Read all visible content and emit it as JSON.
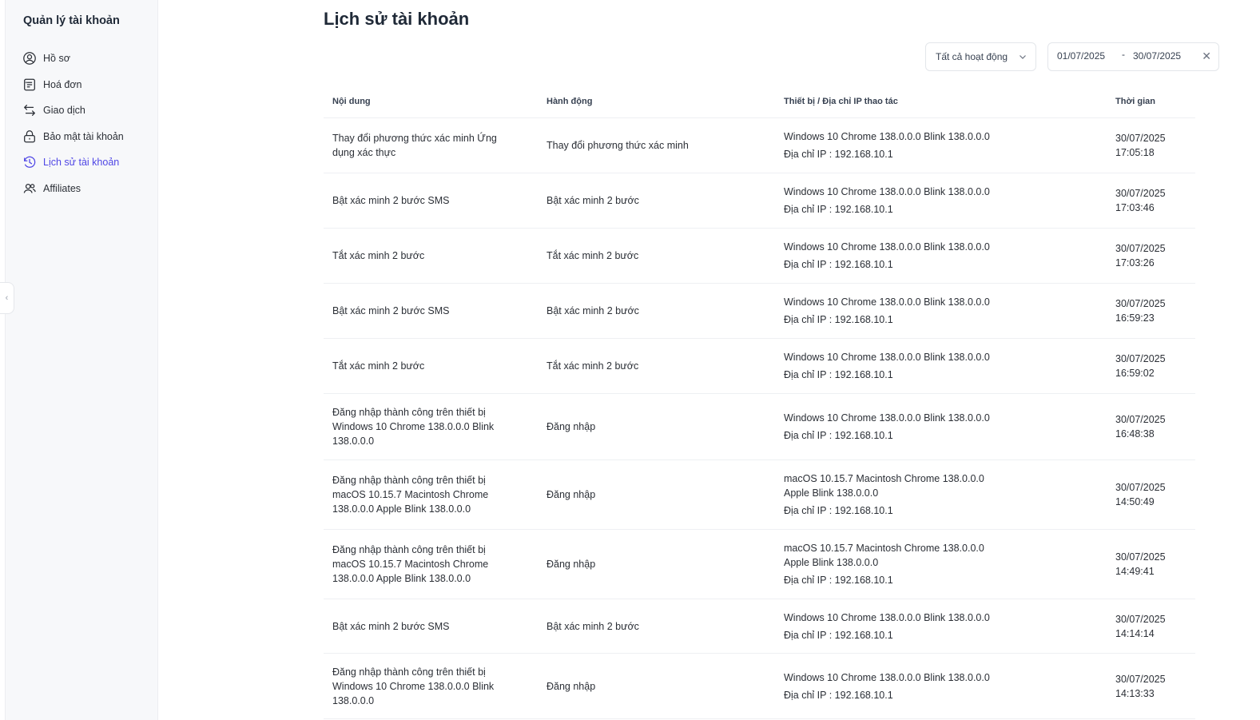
{
  "sidebar": {
    "title": "Quản lý tài khoản",
    "items": [
      {
        "label": "Hồ sơ",
        "icon": "user-circle-icon"
      },
      {
        "label": "Hoá đơn",
        "icon": "receipt-icon"
      },
      {
        "label": "Giao dịch",
        "icon": "transfer-arrows-icon"
      },
      {
        "label": "Bảo mật tài khoản",
        "icon": "lock-icon"
      },
      {
        "label": "Lịch sử tài khoản",
        "icon": "history-clock-icon",
        "active": true
      },
      {
        "label": "Affiliates",
        "icon": "users-icon"
      }
    ],
    "active_color": "#4f46e5"
  },
  "page": {
    "title": "Lịch sử tài khoản"
  },
  "filters": {
    "activity_select": "Tất cả hoạt động",
    "date_from": "01/07/2025",
    "date_separator": "-",
    "date_to": "30/07/2025"
  },
  "table": {
    "headers": {
      "content": "Nội dung",
      "action": "Hành động",
      "device": "Thiết bị / Địa chỉ IP thao tác",
      "time": "Thời gian"
    },
    "rows": [
      {
        "content": "Thay đổi phương thức xác minh Ứng dụng xác thực",
        "action": "Thay đổi phương thức xác minh",
        "device": "Windows 10 Chrome 138.0.0.0 Blink 138.0.0.0",
        "ip": "Địa chỉ IP : 192.168.10.1",
        "date": "30/07/2025",
        "clock": "17:05:18"
      },
      {
        "content": "Bật xác minh 2 bước SMS",
        "action": "Bật xác minh 2 bước",
        "device": "Windows 10 Chrome 138.0.0.0 Blink 138.0.0.0",
        "ip": "Địa chỉ IP : 192.168.10.1",
        "date": "30/07/2025",
        "clock": "17:03:46"
      },
      {
        "content": "Tắt xác minh 2 bước",
        "action": "Tắt xác minh 2 bước",
        "device": "Windows 10 Chrome 138.0.0.0 Blink 138.0.0.0",
        "ip": "Địa chỉ IP : 192.168.10.1",
        "date": "30/07/2025",
        "clock": "17:03:26"
      },
      {
        "content": "Bật xác minh 2 bước SMS",
        "action": "Bật xác minh 2 bước",
        "device": "Windows 10 Chrome 138.0.0.0 Blink 138.0.0.0",
        "ip": "Địa chỉ IP : 192.168.10.1",
        "date": "30/07/2025",
        "clock": "16:59:23"
      },
      {
        "content": "Tắt xác minh 2 bước",
        "action": "Tắt xác minh 2 bước",
        "device": "Windows 10 Chrome 138.0.0.0 Blink 138.0.0.0",
        "ip": "Địa chỉ IP : 192.168.10.1",
        "date": "30/07/2025",
        "clock": "16:59:02"
      },
      {
        "content": "Đăng nhập thành công trên thiết bị Windows 10 Chrome 138.0.0.0 Blink 138.0.0.0",
        "action": "Đăng nhập",
        "device": "Windows 10 Chrome 138.0.0.0 Blink 138.0.0.0",
        "ip": "Địa chỉ IP : 192.168.10.1",
        "date": "30/07/2025",
        "clock": "16:48:38"
      },
      {
        "content": "Đăng nhập thành công trên thiết bị macOS 10.15.7 Macintosh Chrome 138.0.0.0 Apple Blink 138.0.0.0",
        "action": "Đăng nhập",
        "device": "macOS 10.15.7 Macintosh Chrome 138.0.0.0 Apple Blink 138.0.0.0",
        "ip": "Địa chỉ IP : 192.168.10.1",
        "date": "30/07/2025",
        "clock": "14:50:49"
      },
      {
        "content": "Đăng nhập thành công trên thiết bị macOS 10.15.7 Macintosh Chrome 138.0.0.0 Apple Blink 138.0.0.0",
        "action": "Đăng nhập",
        "device": "macOS 10.15.7 Macintosh Chrome 138.0.0.0 Apple Blink 138.0.0.0",
        "ip": "Địa chỉ IP : 192.168.10.1",
        "date": "30/07/2025",
        "clock": "14:49:41"
      },
      {
        "content": "Bật xác minh 2 bước SMS",
        "action": "Bật xác minh 2 bước",
        "device": "Windows 10 Chrome 138.0.0.0 Blink 138.0.0.0",
        "ip": "Địa chỉ IP : 192.168.10.1",
        "date": "30/07/2025",
        "clock": "14:14:14"
      },
      {
        "content": "Đăng nhập thành công trên thiết bị Windows 10 Chrome 138.0.0.0 Blink 138.0.0.0",
        "action": "Đăng nhập",
        "device": "Windows 10 Chrome 138.0.0.0 Blink 138.0.0.0",
        "ip": "Địa chỉ IP : 192.168.10.1",
        "date": "30/07/2025",
        "clock": "14:13:33"
      }
    ]
  }
}
